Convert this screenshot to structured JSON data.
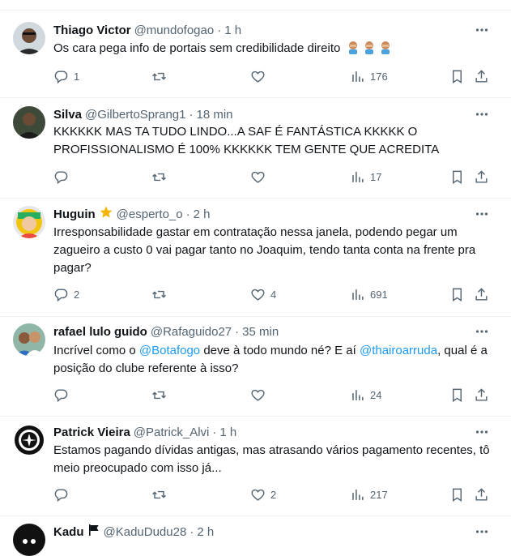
{
  "tweets": [
    {
      "name": "Thiago Victor",
      "handle": "@mundofogao",
      "time": "1 h",
      "text": "Os cara pega info de portais sem credibilidade direito",
      "emoji": "facepalm-emoji-x3",
      "replies": "1",
      "retweets": "",
      "likes": "",
      "views": "176"
    },
    {
      "name": "Silva",
      "handle": "@GilbertoSprang1",
      "time": "18 min",
      "text": "KKKKKK MAS TA TUDO LINDO...A SAF É FANTÁSTICA KKKKK O PROFISSIONALISMO É 100% KKKKKK TEM GENTE QUE ACREDITA",
      "replies": "",
      "retweets": "",
      "likes": "",
      "views": "17"
    },
    {
      "name": "Huguin",
      "handle": "@esperto_o",
      "time": "2 h",
      "text": "Irresponsabilidade gastar em contratação nessa janela, podendo pegar um zagueiro a custo 0 vai pagar tanto no Joaquim, tendo tanta conta na frente pra pagar?",
      "replies": "2",
      "retweets": "",
      "likes": "4",
      "views": "691"
    },
    {
      "name": "rafael lulo guido",
      "handle": "@Rafaguido27",
      "time": "35 min",
      "text_parts": [
        "Incrível como o ",
        "@Botafogo",
        " deve à todo mundo né? E aí ",
        "@thairoarruda",
        ", qual é a posição do clube referente à isso?"
      ],
      "replies": "",
      "retweets": "",
      "likes": "",
      "views": "24"
    },
    {
      "name": "Patrick Vieira",
      "handle": "@Patrick_Alvi",
      "time": "1 h",
      "text": "Estamos pagando dívidas antigas, mas atrasando vários pagamento recentes, tô meio preocupado com isso já...",
      "replies": "",
      "retweets": "",
      "likes": "2",
      "views": "217"
    },
    {
      "name": "Kadu",
      "handle": "@KaduDudu28",
      "time": "2 h"
    }
  ],
  "separator": "·"
}
